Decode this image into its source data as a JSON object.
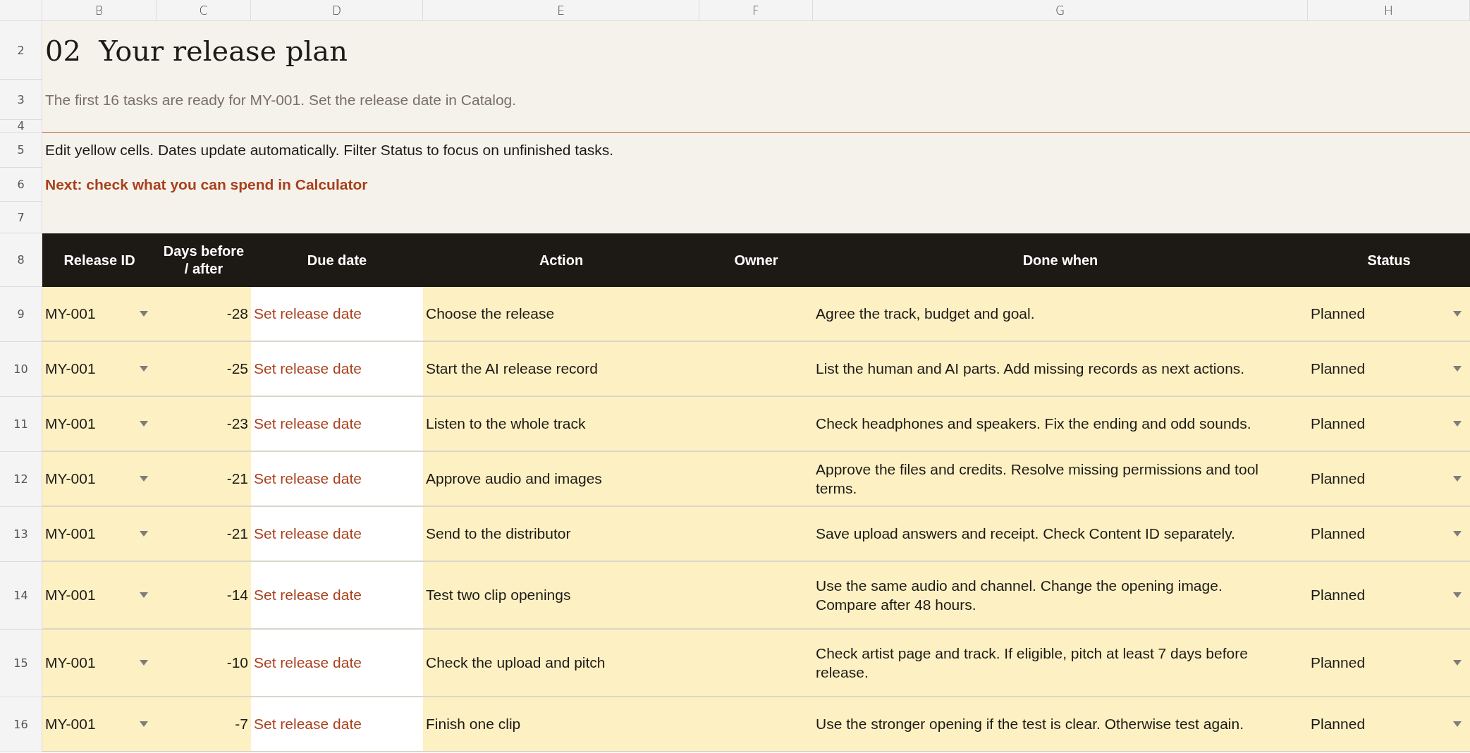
{
  "column_letters": [
    "B",
    "C",
    "D",
    "E",
    "F",
    "G",
    "H"
  ],
  "intro": {
    "row_numbers": [
      "2",
      "3",
      "4",
      "5",
      "6",
      "7"
    ],
    "title": "02  Your release plan",
    "subtitle": "The first 16 tasks are ready for MY-001. Set the release date in Catalog.",
    "instruction": "Edit yellow cells. Dates update automatically. Filter Status to focus on unfinished tasks.",
    "next_link": "Next: check what you can spend in Calculator"
  },
  "table": {
    "header_row_number": "8",
    "columns": [
      "Release ID",
      "Days before / after",
      "Due date",
      "Action",
      "Owner",
      "Done when",
      "Status"
    ],
    "rows": [
      {
        "row_number": "9",
        "release_id": "MY-001",
        "days": "-28",
        "due_date": "Set release date",
        "action": "Choose the release",
        "done_when": "Agree the track, budget and goal.",
        "status": "Planned"
      },
      {
        "row_number": "10",
        "release_id": "MY-001",
        "days": "-25",
        "due_date": "Set release date",
        "action": "Start the AI release record",
        "done_when": "List the human and AI parts. Add missing records as next actions.",
        "status": "Planned"
      },
      {
        "row_number": "11",
        "release_id": "MY-001",
        "days": "-23",
        "due_date": "Set release date",
        "action": "Listen to the whole track",
        "done_when": "Check headphones and speakers. Fix the ending and odd sounds.",
        "status": "Planned"
      },
      {
        "row_number": "12",
        "release_id": "MY-001",
        "days": "-21",
        "due_date": "Set release date",
        "action": "Approve audio and images",
        "done_when": "Approve the files and credits. Resolve missing permissions and tool terms.",
        "status": "Planned"
      },
      {
        "row_number": "13",
        "release_id": "MY-001",
        "days": "-21",
        "due_date": "Set release date",
        "action": "Send to the distributor",
        "done_when": "Save upload answers and receipt. Check Content ID separately.",
        "status": "Planned"
      },
      {
        "row_number": "14",
        "release_id": "MY-001",
        "days": "-14",
        "due_date": "Set release date",
        "action": "Test two clip openings",
        "done_when": "Use the same audio and channel. Change the opening image. Compare after 48 hours.",
        "status": "Planned"
      },
      {
        "row_number": "15",
        "release_id": "MY-001",
        "days": "-10",
        "due_date": "Set release date",
        "action": "Check the upload and pitch",
        "done_when": "Check artist page and track. If eligible, pitch at least 7 days before release.",
        "status": "Planned"
      },
      {
        "row_number": "16",
        "release_id": "MY-001",
        "days": "-7",
        "due_date": "Set release date",
        "action": "Finish one clip",
        "done_when": "Use the stronger opening if the test is clear. Otherwise test again.",
        "status": "Planned"
      }
    ]
  }
}
